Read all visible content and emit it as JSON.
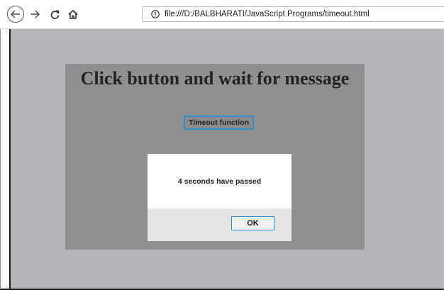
{
  "browser": {
    "url": "file:///D:/BALBHARATI/JavaScript Programs/timeout.html",
    "back_icon": "back-arrow-icon",
    "forward_icon": "forward-arrow-icon",
    "reload_icon": "reload-icon",
    "home_icon": "home-icon",
    "info_icon": "info-icon"
  },
  "page": {
    "heading": "Click button and wait for message",
    "button_label": "Timeout function"
  },
  "alert": {
    "message": "4 seconds have passed",
    "ok_label": "OK"
  },
  "colors": {
    "page_background": "#b5b6b9",
    "panel_background": "#8e8f91",
    "focus_accent": "#2f8fc8"
  }
}
